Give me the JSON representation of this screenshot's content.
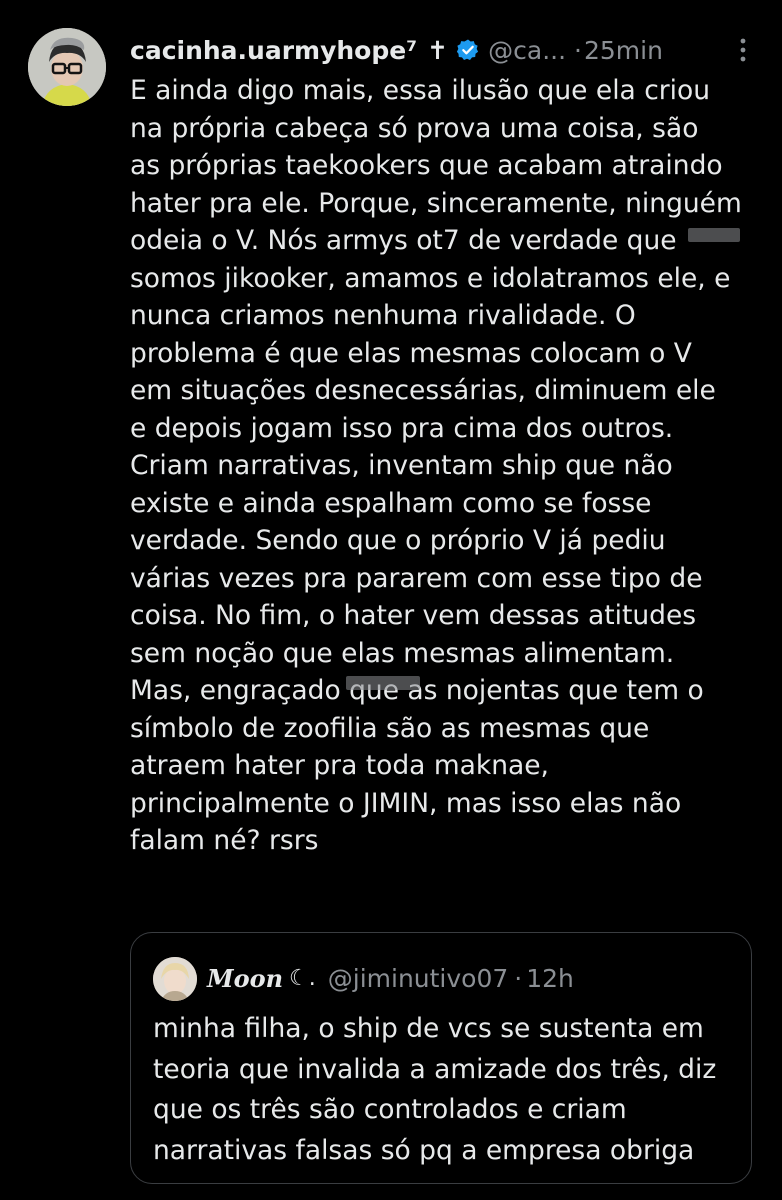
{
  "tweet": {
    "display_name": "cacinha.uarmyhope⁷",
    "cross_symbol": "✝",
    "handle": "@ca...",
    "separator": "·",
    "time": "25min",
    "lines": [
      "E ainda digo mais, essa ilusão que ela criou",
      "na própria cabeça só prova uma coisa, são",
      "as próprias taekookers  que acabam atraindo",
      "hater pra ele. Porque, sinceramente, ninguém",
      "odeia o V. Nós armys ot7 de verdade que",
      "somos jikooker, amamos e idolatramos ele, e",
      "nunca criamos nenhuma rivalidade. O",
      "problema é que elas mesmas colocam o V",
      "em situações desnecessárias, diminuem ele",
      "e depois jogam isso pra cima dos outros.",
      "Criam narrativas, inventam ship que não",
      "existe e ainda espalham como se fosse",
      "verdade. Sendo que o próprio V já pediu",
      "várias vezes pra pararem com esse tipo de",
      "coisa. No fim, o hater vem dessas atitudes",
      "sem noção que elas mesmas alimentam.",
      "Mas, engraçado que as nojentas que tem o",
      "símbolo de zoofilia são as mesmas que",
      "atraem hater pra toda maknae,",
      "principalmente o JIMIN, mas isso elas não",
      "falam né? rsrs"
    ],
    "icons": {
      "verified": "verified-badge-icon",
      "more": "more-options-icon"
    },
    "colors": {
      "background": "#000000",
      "text": "#e7e9ea",
      "secondary": "#8b8f94",
      "verified": "#1d9bf0"
    }
  },
  "quote": {
    "display_name": "Moon",
    "moon_symbol": "☾.",
    "handle": "@jiminutivo07",
    "separator": "·",
    "time": "12h",
    "lines": [
      "minha filha, o ship de vcs se sustenta em",
      "teoria que invalida a amizade dos três, diz",
      "que os três são controlados e criam",
      "narrativas falsas só pq a empresa obriga"
    ]
  }
}
